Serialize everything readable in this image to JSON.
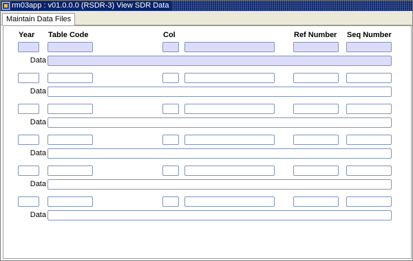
{
  "window": {
    "title": "rm03app : v01.0.0.0 (RSDR-3) View SDR Data"
  },
  "tabs": [
    {
      "label": "Maintain Data Files"
    }
  ],
  "headers": {
    "year": "Year",
    "table_code": "Table Code",
    "col": "Col",
    "ref_number": "Ref Number",
    "seq_number": "Seq Number"
  },
  "records": [
    {
      "year": "",
      "table_code": "",
      "col": "",
      "col_desc": "",
      "ref_number": "",
      "seq_number": "",
      "data_label": "Data",
      "data": ""
    },
    {
      "year": "",
      "table_code": "",
      "col": "",
      "col_desc": "",
      "ref_number": "",
      "seq_number": "",
      "data_label": "Data",
      "data": ""
    },
    {
      "year": "",
      "table_code": "",
      "col": "",
      "col_desc": "",
      "ref_number": "",
      "seq_number": "",
      "data_label": "Data",
      "data": ""
    },
    {
      "year": "",
      "table_code": "",
      "col": "",
      "col_desc": "",
      "ref_number": "",
      "seq_number": "",
      "data_label": "Data",
      "data": ""
    },
    {
      "year": "",
      "table_code": "",
      "col": "",
      "col_desc": "",
      "ref_number": "",
      "seq_number": "",
      "data_label": "Data",
      "data": ""
    },
    {
      "year": "",
      "table_code": "",
      "col": "",
      "col_desc": "",
      "ref_number": "",
      "seq_number": "",
      "data_label": "Data",
      "data": ""
    }
  ],
  "active_row_color": "#dcdcfa"
}
